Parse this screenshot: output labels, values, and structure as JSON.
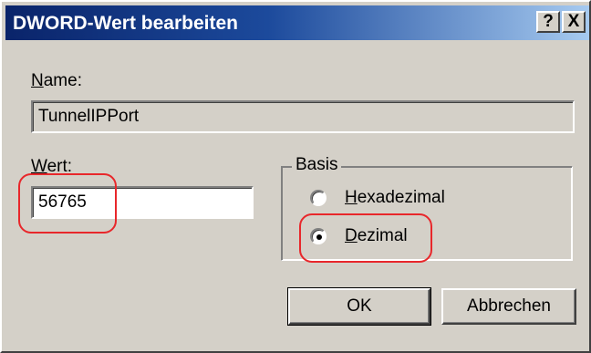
{
  "window": {
    "title": "DWORD-Wert bearbeiten",
    "help_label": "?",
    "close_label": "X"
  },
  "name": {
    "label_accel": "N",
    "label_rest": "ame:",
    "value": "TunnelIPPort"
  },
  "value": {
    "label_accel": "W",
    "label_rest": "ert:",
    "value": "56765"
  },
  "basis": {
    "legend": "Basis",
    "options": [
      {
        "accel": "H",
        "rest": "exadezimal",
        "selected": false
      },
      {
        "accel": "D",
        "rest": "ezimal",
        "selected": true
      }
    ]
  },
  "buttons": {
    "ok_label": "OK",
    "cancel_label": "Abbrechen"
  },
  "annotation_color": "#e8272b",
  "dialog_color": "#d4d0c8",
  "titlebar_color": "#0a246a"
}
